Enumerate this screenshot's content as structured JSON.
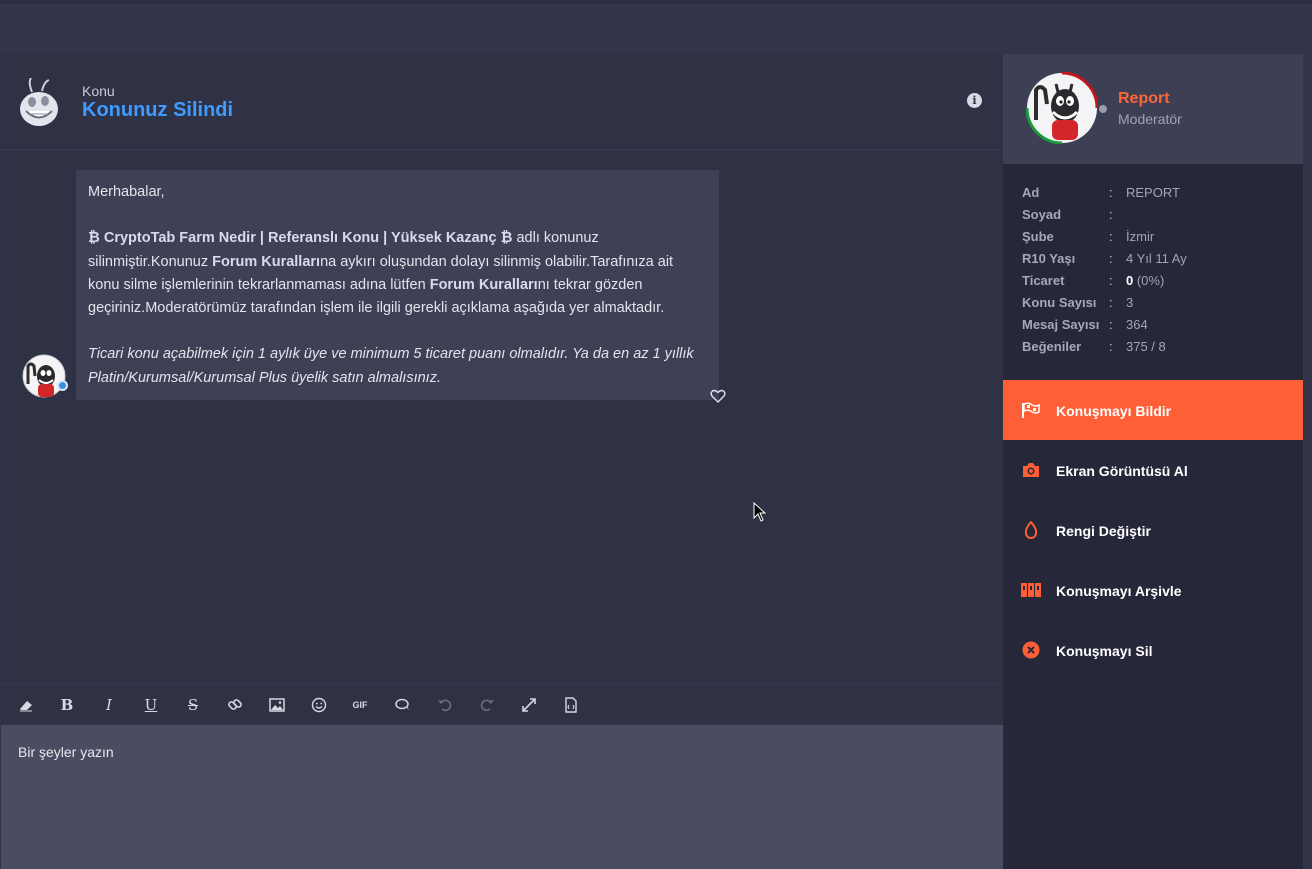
{
  "conversation": {
    "label": "Konu",
    "title": "Konunuz Silindi"
  },
  "message": {
    "greeting": "Merhabalar,",
    "topic_title": "₿ CryptoTab Farm Nedir | Referanslı Konu | Yüksek Kazanç ₿",
    "text_1": " adlı konunuz silinmiştir.Konunuz ",
    "rules_1": "Forum Kuralları",
    "text_2": "na aykırı oluşundan dolayı silinmiş olabilir.Tarafınıza ait konu silme işlemlerinin tekrarlanmaması adına lütfen ",
    "rules_2": "Forum Kuralları",
    "text_3": "nı tekrar gözden geçiriniz.Moderatörümüz tarafından işlem ile ilgili gerekli açıklama aşağıda yer almaktadır.",
    "note": "Ticari konu açabilmek için 1 aylık üye ve minimum 5 ticaret puanı olmalıdır. Ya da en az 1 yıllık Platin/Kurumsal/Kurumsal Plus üyelik satın almalısınız."
  },
  "toolbar": {
    "buttons": [
      "eraser-icon",
      "bold-icon",
      "italic-icon",
      "underline-icon",
      "strikethrough-icon",
      "link-icon",
      "image-icon",
      "emoji-icon",
      "gif-icon",
      "quote-icon",
      "undo-icon",
      "redo-icon",
      "expand-icon",
      "source-icon"
    ],
    "bold": "B",
    "italic": "I",
    "underline": "U",
    "strike": "S",
    "gif": "GIF"
  },
  "editor": {
    "placeholder": "Bir şeyler yazın"
  },
  "profile": {
    "name": "Report",
    "role": "Moderatör",
    "fields": [
      {
        "key": "Ad",
        "value": "REPORT"
      },
      {
        "key": "Soyad",
        "value": ""
      },
      {
        "key": "Şube",
        "value": "İzmir"
      },
      {
        "key": "R10 Yaşı",
        "value": "4 Yıl 11 Ay"
      },
      {
        "key": "Ticaret",
        "value_bold": "0",
        "value": " (0%)"
      },
      {
        "key": "Konu Sayısı",
        "value": "3"
      },
      {
        "key": "Mesaj Sayısı",
        "value": "364"
      },
      {
        "key": "Beğeniler",
        "value": "375 / 8"
      }
    ]
  },
  "actions": [
    {
      "label": "Konuşmayı Bildir",
      "icon": "flag-icon",
      "active": true
    },
    {
      "label": "Ekran Görüntüsü Al",
      "icon": "camera-icon",
      "active": false
    },
    {
      "label": "Rengi Değiştir",
      "icon": "drop-icon",
      "active": false
    },
    {
      "label": "Konuşmayı Arşivle",
      "icon": "archive-icon",
      "active": false
    },
    {
      "label": "Konuşmayı Sil",
      "icon": "delete-icon",
      "active": false
    }
  ],
  "colors": {
    "accent": "#ff5f36",
    "title_blue": "#3f9bff",
    "name_orange": "#ff6633",
    "background": "#2f3244",
    "sidebar": "#262839"
  }
}
